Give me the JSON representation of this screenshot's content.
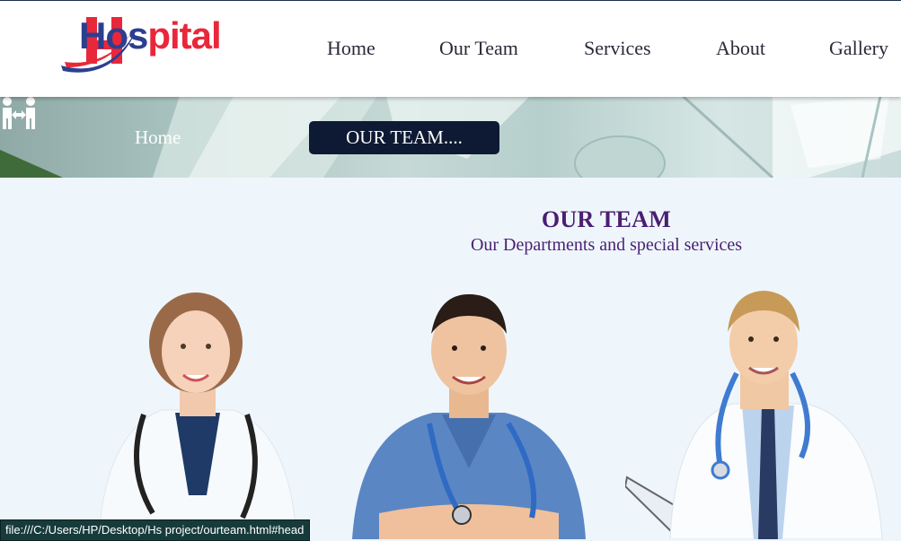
{
  "brand": {
    "part1": "Hos",
    "part2": "pital",
    "logo_letter": "H"
  },
  "nav": {
    "items": [
      {
        "label": "Home"
      },
      {
        "label": "Our Team"
      },
      {
        "label": "Services"
      },
      {
        "label": "About"
      },
      {
        "label": "Gallery"
      }
    ]
  },
  "breadcrumb": {
    "icon": "move-arrows-icon",
    "home_label": "Home",
    "current_label": "OUR TEAM...."
  },
  "section": {
    "title": "OUR TEAM",
    "subtitle": "Our Departments and special services"
  },
  "team": [
    {
      "photo": "female-doctor-photo",
      "scrub_color": "#ffffff"
    },
    {
      "photo": "male-nurse-photo",
      "scrub_color": "#5b86c4"
    },
    {
      "photo": "male-doctor-photo",
      "scrub_color": "#ffffff"
    }
  ],
  "status_bar": {
    "url": "file:///C:/Users/HP/Desktop/Hs project/ourteam.html#head"
  },
  "colors": {
    "accent_purple": "#4b1e72",
    "logo_blue": "#2c3f8f",
    "logo_red": "#e8283a",
    "breadcrumb_bg": "#0e1a34",
    "page_bg": "#eef6fc"
  }
}
